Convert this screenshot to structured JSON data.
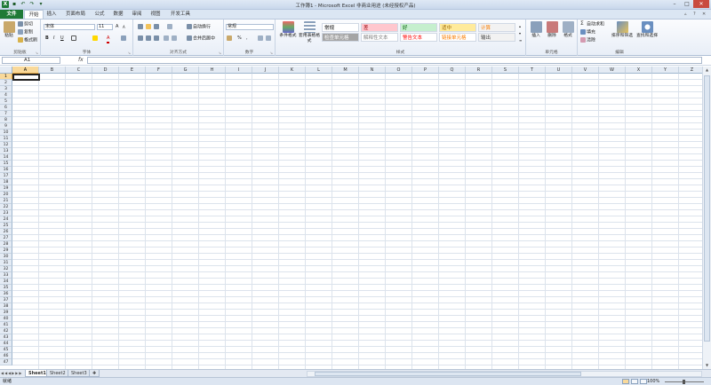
{
  "title": "工作簿1 - Microsoft Excel 非商业用途 (未经授权产品)",
  "tabs": [
    "文件",
    "开始",
    "插入",
    "页面布局",
    "公式",
    "数据",
    "审阅",
    "视图",
    "开发工具"
  ],
  "clipboard": {
    "paste": "粘贴",
    "cut": "剪切",
    "copy": "复制",
    "format_painter": "格式刷",
    "label": "剪贴板"
  },
  "font": {
    "name": "宋体",
    "size": "11",
    "label": "字体",
    "bold": "B",
    "italic": "I",
    "underline": "U",
    "grow": "A",
    "shrink": "A",
    "font_color": "A"
  },
  "alignment": {
    "wrap": "自动换行",
    "merge": "合并后居中",
    "label": "对齐方式"
  },
  "number": {
    "format": "常规",
    "percent": "%",
    "comma": ",",
    "label": "数字"
  },
  "styles": {
    "conditional": "条件格式",
    "table": "套用表格格式",
    "label": "样式",
    "cells": [
      {
        "text": "常规",
        "bg": "#ffffff",
        "fg": "#000000"
      },
      {
        "text": "差",
        "bg": "#ffc7ce",
        "fg": "#9c0006"
      },
      {
        "text": "好",
        "bg": "#c6efce",
        "fg": "#006100"
      },
      {
        "text": "适中",
        "bg": "#ffeb9c",
        "fg": "#9c6500"
      },
      {
        "text": "计算",
        "bg": "#f2f2f2",
        "fg": "#fa7d00"
      },
      {
        "text": "检查单元格",
        "bg": "#a5a5a5",
        "fg": "#ffffff"
      },
      {
        "text": "解释性文本",
        "bg": "#ffffff",
        "fg": "#7f7f7f"
      },
      {
        "text": "警告文本",
        "bg": "#ffffff",
        "fg": "#ff0000"
      },
      {
        "text": "链接单元格",
        "bg": "#ffffff",
        "fg": "#fa7d00"
      },
      {
        "text": "输出",
        "bg": "#f2f2f2",
        "fg": "#3f3f3f"
      }
    ]
  },
  "cells_group": {
    "insert": "插入",
    "delete": "删除",
    "format": "格式",
    "label": "单元格"
  },
  "editing": {
    "autosum": "自动求和",
    "fill": "填充",
    "clear": "清除",
    "sort": "排序和筛选",
    "find": "查找和选择",
    "label": "编辑"
  },
  "namebox": "A1",
  "fx": "fx",
  "columns": [
    "A",
    "B",
    "C",
    "D",
    "E",
    "F",
    "G",
    "H",
    "I",
    "J",
    "K",
    "L",
    "M",
    "N",
    "O",
    "P",
    "Q",
    "R",
    "S",
    "T",
    "U",
    "V",
    "W",
    "X",
    "Y",
    "Z"
  ],
  "row_count": 47,
  "sheets": [
    "Sheet1",
    "Sheet2",
    "Sheet3"
  ],
  "status": "就绪",
  "zoom": "100%",
  "accent": "#1f7a37",
  "selection_color": "#f9d99a"
}
